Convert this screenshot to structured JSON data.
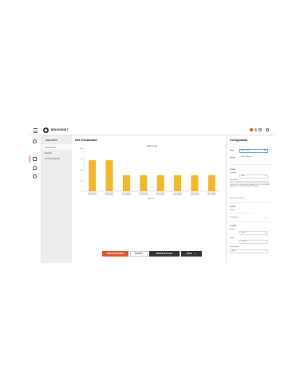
{
  "header": {
    "brand": "BRIDGENET",
    "status_colors": [
      "#e8532d",
      "#f5a623"
    ],
    "icons": [
      "menu-icon",
      "brand-logo-icon",
      "notification-icon",
      "settings-icon"
    ]
  },
  "rail": {
    "icons": [
      "home-icon",
      "analytics-icon",
      "user-icon",
      "settings-icon"
    ]
  },
  "sidebar": {
    "title": "ANALYTICS",
    "items": [
      {
        "label": "Visualisation",
        "active": true
      },
      {
        "label": "Reports",
        "active": false
      },
      {
        "label": "Archived Reports",
        "active": false
      }
    ]
  },
  "main": {
    "title": "Edit Visualisation"
  },
  "chart_data": {
    "type": "bar",
    "title": "ENB_Load",
    "categories": [
      "2G-VLT-6Q1500RLU-7H1000",
      "2G-VLT-6Q1500RLU-4H1000",
      "2G-VLT-6Q1500RLU-7H1000",
      "2G-VLT-6Q1500RLU-4H1000",
      "2G-VLT-6Q1500RLU-7H1000",
      "2G-VLT-6Q1500RLU-7H1000",
      "2G-VLT-6Q1500RLU-4H1000",
      "2G-VLT-6Q1500RLU-7H1000"
    ],
    "series": [
      {
        "name": "Load",
        "values": [
          72,
          72,
          37,
          37,
          37,
          37,
          37,
          37
        ]
      }
    ],
    "ylim": [
      0,
      100
    ],
    "yticks": [
      0,
      25,
      50,
      75,
      100
    ],
    "bar_color": "#f7b52c",
    "legend": "bottom",
    "grid": false
  },
  "actions": {
    "primary": "UPDATE RECORD",
    "cancel": "CANCEL",
    "preview": "PREVIEW IN FILE",
    "save": "SAVE"
  },
  "config": {
    "title": "Configuration",
    "name_label": "Name",
    "name_value": "ENB_Load",
    "group_label": "Group",
    "group_value": "TCSP Networks",
    "x_axis_label": "X-AXIS",
    "category_label": "Category",
    "category_value": "Vanc",
    "query_label": "Query Info",
    "query_text": "2G-VLT-6Q1500RLU-7H1000, 2G-VLT-6Q1500RLU-4H1000, 2G-VLT-6Q1500RLU-7H1000, 2G-VLT-6Q1500RLU-4H1000, 2G-VLT-6Q1500RLU-7H1000",
    "conditions_link": "Conditions Selected",
    "y_axis_label": "Y-AXIS",
    "y_label": "Label",
    "first_series_label": "First Series",
    "y2_axis_label": "Y2-AXIS",
    "active_label": "Active",
    "active_value": "None",
    "label2": "Label",
    "label2_value": "ID value",
    "time_frame_label": "Time Frame",
    "time_frame_value": "None"
  }
}
